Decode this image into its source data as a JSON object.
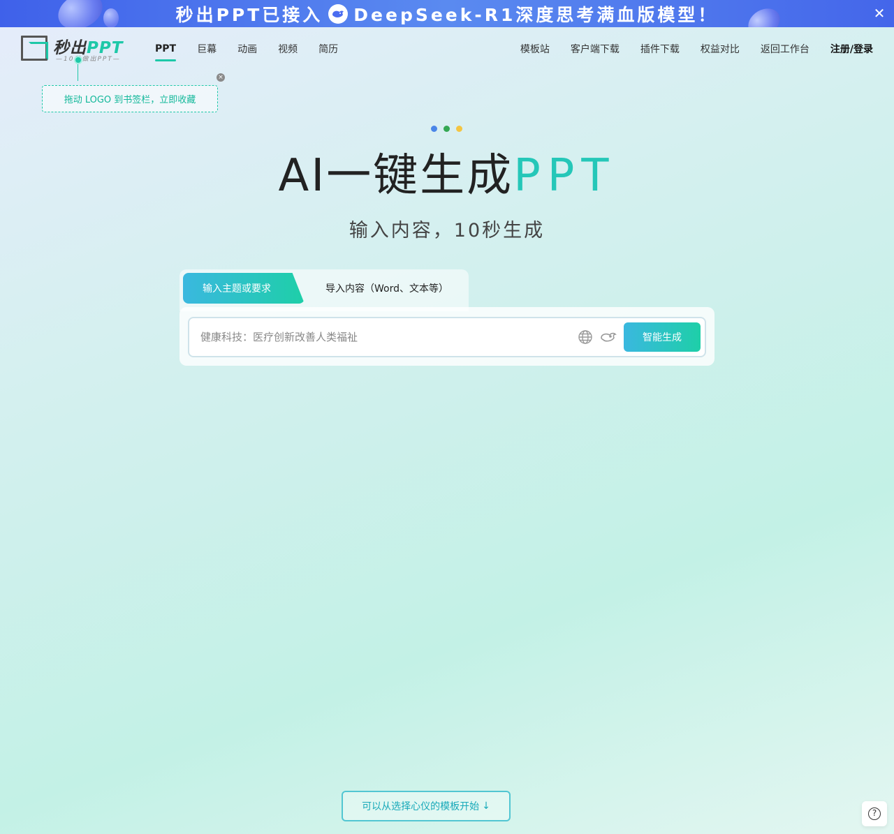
{
  "banner": {
    "text_before": "秒出PPT已接入",
    "text_after": "DeepSeek-R1深度思考满血版模型！",
    "close_glyph": "✕"
  },
  "logo": {
    "title_main": "秒出",
    "title_ppt": "PPT",
    "subtitle": "—10秒做出PPT—"
  },
  "nav_left": {
    "items": [
      "PPT",
      "巨幕",
      "动画",
      "视频",
      "简历"
    ],
    "active": "PPT"
  },
  "nav_right": {
    "items": [
      "模板站",
      "客户端下载",
      "插件下载",
      "权益对比",
      "返回工作台"
    ],
    "login": "注册/登录"
  },
  "tooltip": {
    "text": "拖动 LOGO 到书签栏，立即收藏",
    "close_glyph": "×"
  },
  "hero": {
    "title_main": "AI一键生成",
    "title_accent": "PPT",
    "subtitle": "输入内容，10秒生成",
    "dot_colors": [
      "#4a86e8",
      "#34a853",
      "#f4c542"
    ]
  },
  "tabs": {
    "active": "输入主题或要求",
    "inactive": "导入内容（Word、文本等）"
  },
  "input": {
    "placeholder": "健康科技：医疗创新改善人类福祉",
    "value": ""
  },
  "generate_button": "智能生成",
  "bottom_button": {
    "label": "可以从选择心仪的模板开始",
    "arrow": "↓"
  },
  "help_glyph": "?",
  "colors": {
    "accent": "#1ec8a8",
    "banner": "#4a72ec",
    "gradient_start": "#3ab8df",
    "gradient_end": "#1ecfa8"
  }
}
